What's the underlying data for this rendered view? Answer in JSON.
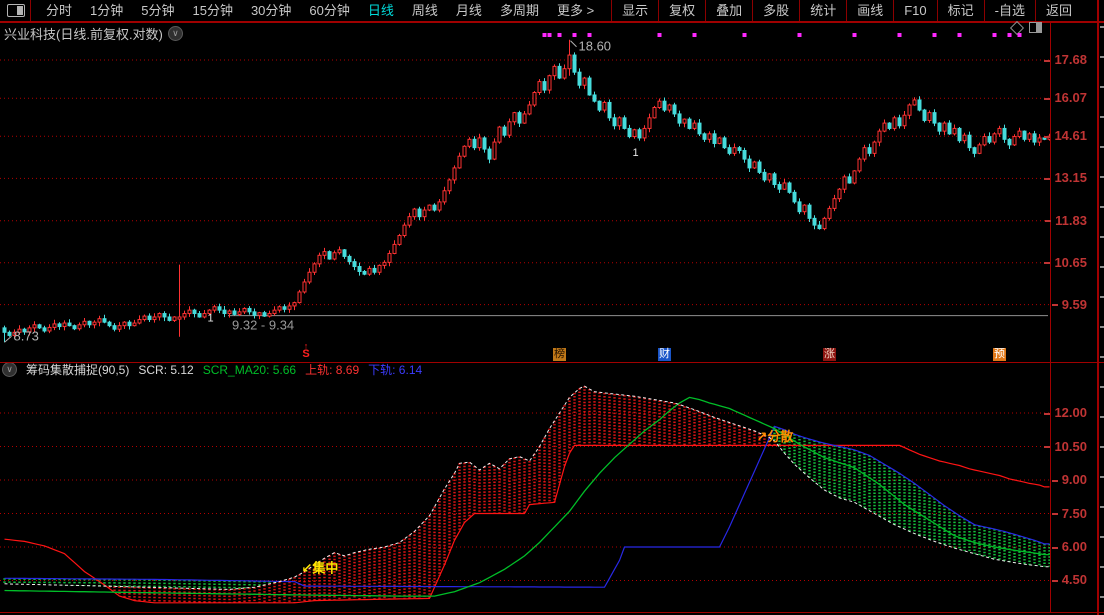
{
  "toolbar": {
    "left_items": [
      "分时",
      "1分钟",
      "5分钟",
      "15分钟",
      "30分钟",
      "60分钟",
      "日线",
      "周线",
      "月线",
      "多周期",
      "更多 >"
    ],
    "active_item": "日线",
    "right_items": [
      "显示",
      "复权",
      "叠加",
      "多股",
      "统计",
      "画线",
      "F10",
      "标记",
      "-自选",
      "返回"
    ]
  },
  "title": {
    "text": "兴业科技(日线.前复权.对数)"
  },
  "indicator": {
    "name_text": "筹码集散捕捉(90,5)",
    "scr_text": "SCR: 5.12",
    "ma_text": "SCR_MA20: 5.66",
    "upper_text": "上轨: 8.69",
    "lower_text": "下轨: 6.14"
  },
  "colors": {
    "up_candle": "#ff3232",
    "down_candle": "#46dcdc",
    "grid": "#b40000",
    "axis_text": "#c03434",
    "event_dot": "#ff28ff",
    "ref_line": "#909090",
    "scr_line": "#f0f0f0",
    "ma_line": "#00be28",
    "upper_line": "#ff1414",
    "lower_line": "#2828e6",
    "fill_red": "#d81414",
    "fill_green": "#14be3c",
    "label_concentrate": "#ffe400",
    "label_disperse": "#ff8c00"
  },
  "chart_data": [
    {
      "type": "candlestick",
      "panel": "main",
      "scale": "log",
      "y_ticks": [
        17.68,
        16.07,
        14.61,
        13.15,
        11.83,
        10.65,
        9.59
      ],
      "high_label": {
        "text": "18.60",
        "index": 113
      },
      "low_label": {
        "text": "8.73",
        "index": 0
      },
      "ref_line": {
        "label": "9.32 - 9.34",
        "value": 9.33,
        "start_index": 45
      },
      "closes": [
        8.95,
        8.88,
        8.95,
        9.02,
        8.96,
        9.05,
        9.12,
        9.05,
        8.98,
        9.06,
        9.14,
        9.08,
        9.16,
        9.1,
        9.03,
        9.12,
        9.2,
        9.12,
        9.18,
        9.26,
        9.18,
        9.1,
        9.02,
        9.1,
        9.18,
        9.1,
        9.16,
        9.24,
        9.32,
        9.24,
        9.3,
        9.38,
        9.3,
        9.22,
        9.3,
        9.3,
        9.38,
        9.46,
        9.38,
        9.3,
        9.38,
        9.46,
        9.54,
        9.46,
        9.38,
        9.44,
        9.36,
        9.42,
        9.5,
        9.42,
        9.34,
        9.4,
        9.32,
        9.38,
        9.46,
        9.54,
        9.48,
        9.56,
        9.64,
        9.9,
        10.15,
        10.4,
        10.62,
        10.85,
        10.95,
        10.75,
        10.92,
        11.0,
        10.82,
        10.68,
        10.55,
        10.42,
        10.35,
        10.5,
        10.4,
        10.58,
        10.66,
        10.9,
        11.15,
        11.4,
        11.7,
        11.95,
        12.18,
        11.95,
        12.15,
        12.3,
        12.15,
        12.4,
        12.75,
        13.1,
        13.5,
        13.9,
        14.25,
        14.5,
        14.2,
        14.55,
        14.15,
        13.8,
        14.4,
        14.95,
        14.65,
        15.15,
        15.5,
        15.1,
        15.45,
        15.8,
        16.3,
        16.75,
        16.4,
        17.0,
        17.4,
        16.9,
        17.3,
        17.9,
        17.15,
        16.6,
        16.9,
        16.2,
        15.95,
        15.6,
        15.9,
        15.3,
        15.0,
        15.3,
        14.9,
        14.6,
        14.85,
        14.55,
        14.9,
        15.3,
        15.7,
        15.95,
        15.6,
        15.8,
        15.45,
        15.1,
        15.25,
        14.9,
        15.1,
        14.7,
        14.5,
        14.7,
        14.35,
        14.55,
        14.2,
        14.0,
        14.2,
        14.1,
        13.8,
        13.5,
        13.7,
        13.35,
        13.1,
        13.3,
        12.95,
        12.8,
        13.0,
        12.7,
        12.4,
        12.1,
        12.3,
        11.9,
        11.7,
        11.6,
        11.9,
        12.2,
        12.5,
        12.8,
        13.2,
        13.0,
        13.4,
        13.8,
        14.2,
        14.0,
        14.4,
        14.8,
        15.1,
        14.9,
        15.3,
        15.0,
        15.4,
        15.8,
        16.0,
        15.6,
        15.2,
        15.5,
        15.1,
        14.8,
        15.1,
        14.7,
        14.9,
        14.45,
        14.65,
        14.2,
        14.0,
        14.3,
        14.6,
        14.4,
        14.7,
        14.9,
        14.5,
        14.3,
        14.6,
        14.8,
        14.5,
        14.7,
        14.4,
        14.55,
        14.5,
        14.61
      ],
      "candle_overrides": {
        "0": [
          9.05,
          9.1,
          8.73,
          8.95
        ],
        "35": [
          9.25,
          10.6,
          8.85,
          9.3
        ],
        "113": [
          17.3,
          18.6,
          17.0,
          17.9
        ]
      },
      "event_dot_indices": [
        108,
        109,
        111,
        114,
        117,
        131,
        138,
        148,
        159,
        170,
        179,
        186,
        191,
        198,
        201,
        203
      ],
      "markers": [
        {
          "text": "1",
          "index": 41,
          "price": 9.2
        },
        {
          "text": "1",
          "index": 126,
          "price": 13.9
        }
      ],
      "badges": [
        {
          "text": "S",
          "index": 60,
          "style": "signal"
        },
        {
          "text": "榜",
          "index": 111,
          "bg": "#c07818",
          "fg": "#241200"
        },
        {
          "text": "财",
          "index": 132,
          "bg": "#1a55c8",
          "fg": "#ffffff"
        },
        {
          "text": "涨",
          "index": 165,
          "bg": "#8c1410",
          "fg": "#f0d2c0"
        },
        {
          "text": "预",
          "index": 199,
          "bg": "#e07818",
          "fg": "#ffffff"
        }
      ]
    },
    {
      "type": "band-indicator",
      "panel": "sub",
      "name": "筹码集散捕捉(90,5)",
      "values": {
        "SCR": 5.12,
        "SCR_MA20": 5.66,
        "上轨": 8.69,
        "下轨": 6.14
      },
      "y_ticks": [
        12.0,
        10.5,
        9.0,
        7.5,
        6.0,
        4.5
      ],
      "series": {
        "scr": {
          "style": "white-dashed",
          "points": [
            [
              0,
              4.35
            ],
            [
              20,
              4.25
            ],
            [
              45,
              4.1
            ],
            [
              50,
              4.2
            ],
            [
              55,
              4.45
            ],
            [
              58,
              4.65
            ],
            [
              60,
              4.9
            ],
            [
              62,
              5.2
            ],
            [
              64,
              5.5
            ],
            [
              66,
              5.75
            ],
            [
              68,
              5.6
            ],
            [
              70,
              5.75
            ],
            [
              73,
              5.9
            ],
            [
              76,
              6.0
            ],
            [
              79,
              6.2
            ],
            [
              82,
              6.7
            ],
            [
              85,
              7.4
            ],
            [
              88,
              8.6
            ],
            [
              90,
              9.3
            ],
            [
              91,
              9.75
            ],
            [
              93,
              9.8
            ],
            [
              95,
              9.45
            ],
            [
              97,
              9.75
            ],
            [
              99,
              9.5
            ],
            [
              101,
              9.95
            ],
            [
              103,
              10.05
            ],
            [
              105,
              9.85
            ],
            [
              107,
              10.5
            ],
            [
              109,
              11.3
            ],
            [
              111,
              12.0
            ],
            [
              113,
              12.7
            ],
            [
              115,
              13.1
            ],
            [
              116,
              13.2
            ],
            [
              118,
              12.95
            ],
            [
              122,
              12.85
            ],
            [
              126,
              12.75
            ],
            [
              130,
              12.6
            ],
            [
              134,
              12.45
            ],
            [
              138,
              12.15
            ],
            [
              142,
              11.8
            ],
            [
              146,
              11.5
            ],
            [
              150,
              11.2
            ],
            [
              153,
              10.9
            ],
            [
              154,
              10.75
            ],
            [
              156,
              10.2
            ],
            [
              158,
              9.7
            ],
            [
              161,
              9.1
            ],
            [
              164,
              8.55
            ],
            [
              167,
              8.2
            ],
            [
              170,
              8.0
            ],
            [
              174,
              7.5
            ],
            [
              178,
              7.0
            ],
            [
              182,
              6.6
            ],
            [
              186,
              6.25
            ],
            [
              190,
              5.95
            ],
            [
              194,
              5.7
            ],
            [
              198,
              5.45
            ],
            [
              202,
              5.3
            ],
            [
              205,
              5.2
            ],
            [
              207,
              5.15
            ],
            [
              208,
              5.12
            ]
          ]
        },
        "scr_ma20": {
          "style": "green-solid",
          "points": [
            [
              0,
              4.05
            ],
            [
              30,
              3.95
            ],
            [
              60,
              3.85
            ],
            [
              80,
              3.8
            ],
            [
              86,
              3.8
            ],
            [
              90,
              4.0
            ],
            [
              95,
              4.4
            ],
            [
              100,
              5.0
            ],
            [
              104,
              5.6
            ],
            [
              107,
              6.2
            ],
            [
              110,
              6.9
            ],
            [
              113,
              7.6
            ],
            [
              116,
              8.5
            ],
            [
              119,
              9.3
            ],
            [
              122,
              10.0
            ],
            [
              125,
              10.6
            ],
            [
              128,
              11.2
            ],
            [
              131,
              11.7
            ],
            [
              133,
              12.1
            ],
            [
              135,
              12.45
            ],
            [
              137,
              12.7
            ],
            [
              139,
              12.6
            ],
            [
              141,
              12.45
            ],
            [
              145,
              12.2
            ],
            [
              150,
              11.7
            ],
            [
              154,
              11.3
            ],
            [
              159,
              10.6
            ],
            [
              164,
              10.0
            ],
            [
              168,
              9.7
            ],
            [
              170,
              9.55
            ],
            [
              175,
              8.8
            ],
            [
              180,
              7.9
            ],
            [
              185,
              7.2
            ],
            [
              190,
              6.5
            ],
            [
              194,
              6.2
            ],
            [
              198,
              6.0
            ],
            [
              202,
              5.85
            ],
            [
              206,
              5.73
            ],
            [
              208,
              5.66
            ]
          ]
        },
        "upper": {
          "style": "red-solid",
          "points": [
            [
              0,
              6.35
            ],
            [
              4,
              6.25
            ],
            [
              8,
              6.05
            ],
            [
              12,
              5.7
            ],
            [
              16,
              4.9
            ],
            [
              20,
              4.3
            ],
            [
              23,
              3.8
            ],
            [
              26,
              3.6
            ],
            [
              30,
              3.5
            ],
            [
              58,
              3.5
            ],
            [
              62,
              3.6
            ],
            [
              85,
              3.7
            ],
            [
              86,
              4.2
            ],
            [
              88,
              5.2
            ],
            [
              90,
              6.3
            ],
            [
              92,
              7.1
            ],
            [
              94,
              7.5
            ],
            [
              104,
              7.5
            ],
            [
              105,
              7.9
            ],
            [
              110,
              8.0
            ],
            [
              111,
              8.8
            ],
            [
              112,
              9.6
            ],
            [
              113,
              10.2
            ],
            [
              114,
              10.55
            ],
            [
              179,
              10.55
            ],
            [
              181,
              10.35
            ],
            [
              183,
              10.15
            ],
            [
              185,
              10.0
            ],
            [
              187,
              9.85
            ],
            [
              189,
              9.75
            ],
            [
              191,
              9.65
            ],
            [
              193,
              9.5
            ],
            [
              195,
              9.4
            ],
            [
              197,
              9.3
            ],
            [
              199,
              9.2
            ],
            [
              201,
              9.05
            ],
            [
              203,
              8.95
            ],
            [
              205,
              8.85
            ],
            [
              207,
              8.77
            ],
            [
              208,
              8.69
            ]
          ]
        },
        "lower": {
          "style": "blue-solid",
          "points": [
            [
              0,
              4.6
            ],
            [
              30,
              4.55
            ],
            [
              58,
              4.45
            ],
            [
              60,
              4.25
            ],
            [
              120,
              4.2
            ],
            [
              121,
              4.6
            ],
            [
              123,
              5.4
            ],
            [
              124,
              6.0
            ],
            [
              143,
              6.0
            ],
            [
              145,
              6.9
            ],
            [
              147,
              7.9
            ],
            [
              149,
              8.9
            ],
            [
              151,
              9.9
            ],
            [
              153,
              10.9
            ],
            [
              154,
              11.4
            ],
            [
              156,
              11.25
            ],
            [
              158,
              11.05
            ],
            [
              160,
              10.9
            ],
            [
              163,
              10.7
            ],
            [
              166,
              10.55
            ],
            [
              170,
              10.35
            ],
            [
              173,
              10.1
            ],
            [
              176,
              9.7
            ],
            [
              179,
              9.3
            ],
            [
              182,
              8.85
            ],
            [
              185,
              8.35
            ],
            [
              188,
              7.85
            ],
            [
              191,
              7.4
            ],
            [
              194,
              7.0
            ],
            [
              197,
              6.85
            ],
            [
              200,
              6.7
            ],
            [
              203,
              6.5
            ],
            [
              206,
              6.3
            ],
            [
              208,
              6.14
            ]
          ]
        }
      },
      "fills": {
        "scr_above_upper": "red-dotted",
        "scr_below_lower": "green-dotted"
      },
      "labels": [
        {
          "text": "↙集中",
          "index": 61,
          "value": 4.85,
          "color": "#ffe400"
        },
        {
          "text": "↗分散",
          "index": 152,
          "value": 10.75,
          "color": "#ff8c00"
        }
      ]
    }
  ]
}
